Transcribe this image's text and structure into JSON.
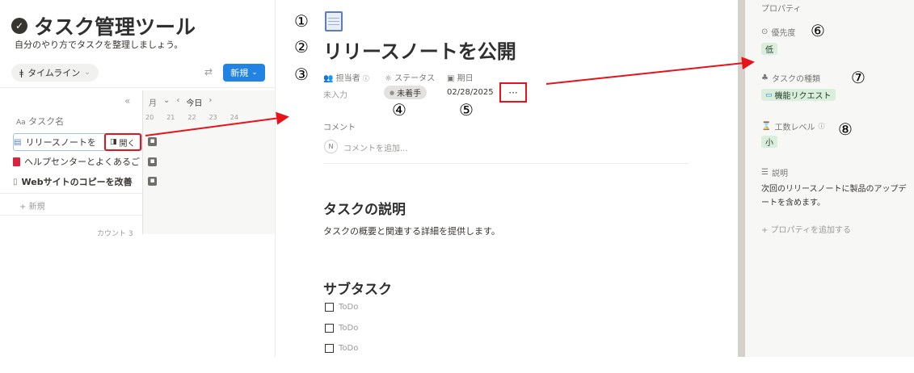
{
  "left": {
    "title": "タスク管理ツール",
    "subtitle": "自分のやり方でタスクを整理しましょう。",
    "view_label": "タイムライン",
    "new_label": "新規",
    "month_suffix": "月",
    "today_label": "今日",
    "days": [
      "20",
      "21",
      "22",
      "23",
      "24"
    ],
    "column_header": "タスク名",
    "rows": [
      {
        "label": "リリースノートを"
      },
      {
        "label": "ヘルプセンターとよくあるご"
      },
      {
        "label": "Webサイトのコピーを改善"
      }
    ],
    "open_label": "開く",
    "new_row_label": "新規",
    "count_label": "カウント 3"
  },
  "center": {
    "markers": [
      "①",
      "②",
      "③",
      "④",
      "⑤"
    ],
    "page_title": "リリースノートを公開",
    "props": {
      "assignee_label": "担当者",
      "status_label": "ステータス",
      "date_label": "期日",
      "assignee_value": "未入力",
      "status_value": "未着手",
      "date_value": "02/28/2025",
      "more": "···"
    },
    "comment_label": "コメント",
    "avatar_initial": "N",
    "comment_placeholder": "コメントを追加...",
    "description_heading": "タスクの説明",
    "description_text": "タスクの概要と関連する詳細を提供します。",
    "subtask_heading": "サブタスク",
    "todos": [
      "ToDo",
      "ToDo",
      "ToDo"
    ]
  },
  "right": {
    "properties_header": "プロパティ",
    "markers": [
      "⑥",
      "⑦",
      "⑧"
    ],
    "priority_label": "優先度",
    "priority_value": "低",
    "type_label": "タスクの種類",
    "type_value": "機能リクエスト",
    "effort_label": "工数レベル",
    "effort_value": "小",
    "desc_label": "説明",
    "desc_text": "次回のリリースノートに製品のアップデートを含めます。",
    "add_property": "+ プロパティを追加する"
  },
  "colors": {
    "accent": "#2383e2",
    "highlight": "#e8121b",
    "tag_green": "#dbeddb",
    "status_gray": "#e3e2e0",
    "sidebar_bg": "#f7f7f5"
  }
}
